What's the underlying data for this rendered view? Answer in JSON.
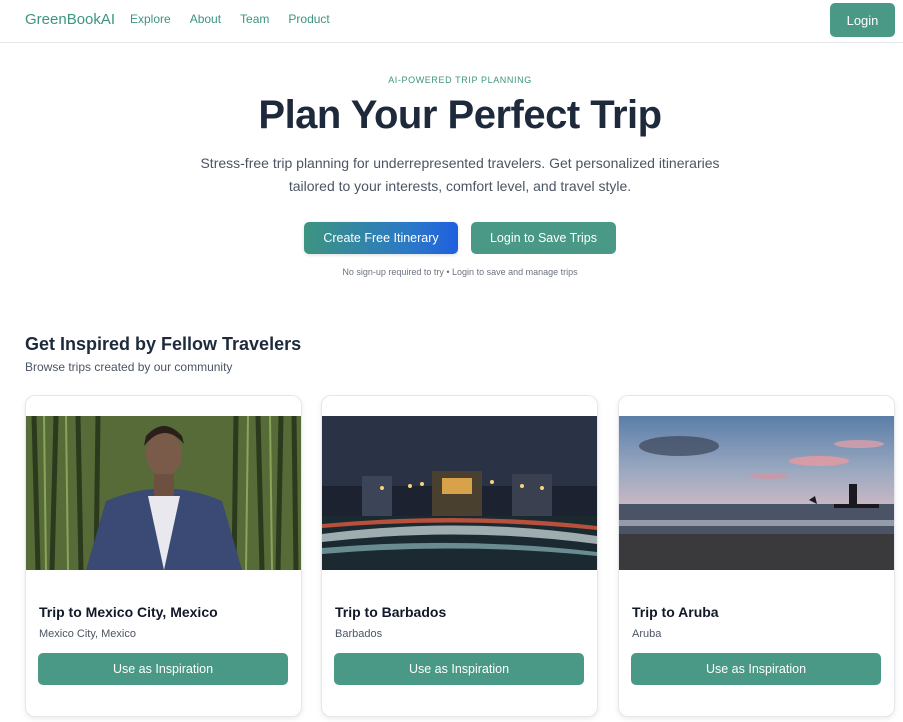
{
  "header": {
    "brand": "GreenBookAI",
    "nav": [
      "Explore",
      "About",
      "Team",
      "Product"
    ],
    "login_label": "Login"
  },
  "hero": {
    "eyebrow": "AI-POWERED TRIP PLANNING",
    "title": "Plan Your Perfect Trip",
    "subtitle": "Stress-free trip planning for underrepresented travelers. Get personalized itineraries tailored to your interests, comfort level, and travel style.",
    "primary_cta": "Create Free Itinerary",
    "secondary_cta": "Login to Save Trips",
    "note": "No sign-up required to try • Login to save and manage trips"
  },
  "inspiration": {
    "title": "Get Inspired by Fellow Travelers",
    "subtitle": "Browse trips created by our community",
    "cards": [
      {
        "title": "Trip to Mexico City, Mexico",
        "location": "Mexico City, Mexico",
        "button": "Use as Inspiration"
      },
      {
        "title": "Trip to Barbados",
        "location": "Barbados",
        "button": "Use as Inspiration"
      },
      {
        "title": "Trip to Aruba",
        "location": "Aruba",
        "button": "Use as Inspiration"
      }
    ]
  },
  "colors": {
    "brand": "#3d9480",
    "button": "#4a9886",
    "heading": "#1e2a3b",
    "gradient_end": "#1f5fe0"
  }
}
